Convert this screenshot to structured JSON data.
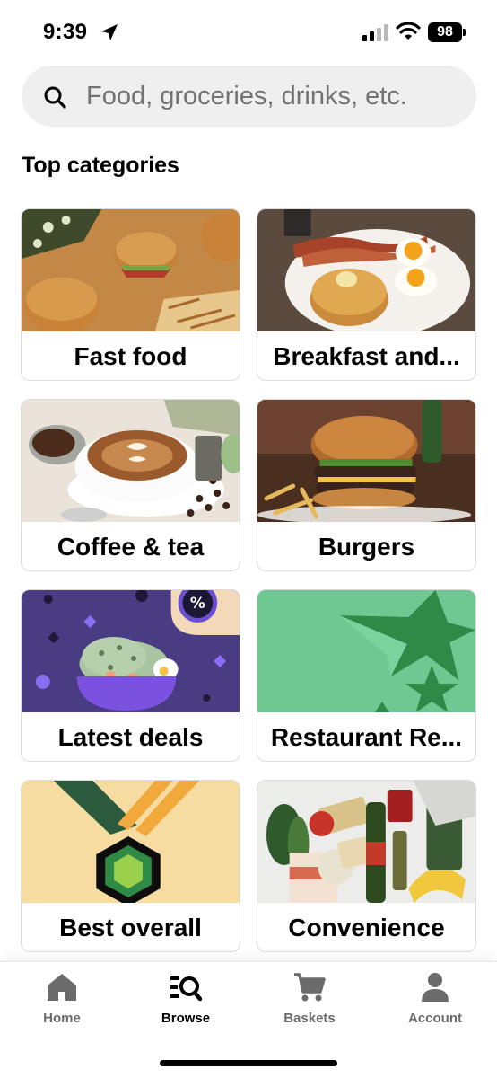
{
  "status": {
    "time": "9:39",
    "battery": "98",
    "icons": [
      "location-arrow-icon",
      "cell-signal-icon",
      "wifi-icon",
      "battery-icon"
    ]
  },
  "search": {
    "placeholder": "Food, groceries, drinks, etc.",
    "icon": "search-icon"
  },
  "section": {
    "title": "Top categories"
  },
  "categories": [
    {
      "label": "Fast food"
    },
    {
      "label": "Breakfast and..."
    },
    {
      "label": "Coffee & tea"
    },
    {
      "label": "Burgers"
    },
    {
      "label": "Latest deals"
    },
    {
      "label": "Restaurant Re..."
    },
    {
      "label": "Best overall"
    },
    {
      "label": "Convenience"
    }
  ],
  "nav": {
    "items": [
      {
        "label": "Home",
        "icon": "home-icon"
      },
      {
        "label": "Browse",
        "icon": "browse-icon",
        "active": true
      },
      {
        "label": "Baskets",
        "icon": "cart-icon"
      },
      {
        "label": "Account",
        "icon": "account-icon"
      }
    ]
  },
  "colors": {
    "search_bg": "#efefef",
    "deals_bg": "#4a3c82",
    "restaurant_bg": "#6fc892",
    "best_bg": "#f6dca0",
    "nav_inactive": "#6b6b6b"
  }
}
